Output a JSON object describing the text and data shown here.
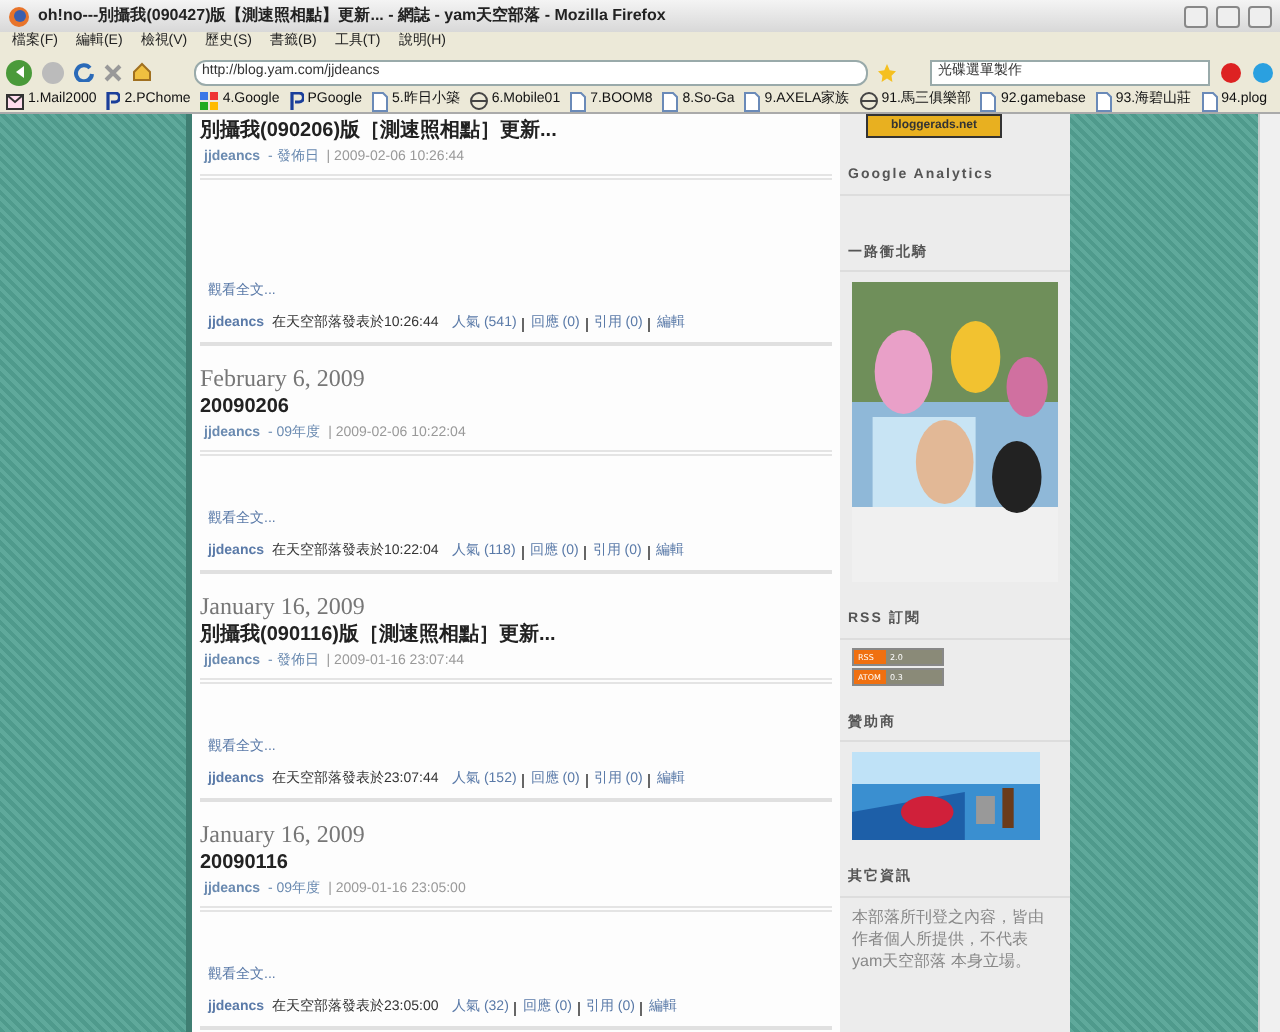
{
  "window": {
    "title": "oh!no---別攝我(090427)版【測速照相點】更新... - 網誌 - yam天空部落 - Mozilla Firefox"
  },
  "menu": [
    "檔案(F)",
    "編輯(E)",
    "檢視(V)",
    "歷史(S)",
    "書籤(B)",
    "工具(T)",
    "說明(H)"
  ],
  "address": {
    "value": "http://blog.yam.com/jjdeancs"
  },
  "search": {
    "value": "光碟選單製作"
  },
  "bookmarks": [
    {
      "label": "1.Mail2000",
      "kind": "mail"
    },
    {
      "label": "2.PChome",
      "kind": "p"
    },
    {
      "label": "4.Google",
      "kind": "google"
    },
    {
      "label": "PGoogle",
      "kind": "p"
    },
    {
      "label": "5.昨日小築",
      "kind": "page"
    },
    {
      "label": "6.Mobile01",
      "kind": "mobile"
    },
    {
      "label": "7.BOOM8",
      "kind": "page"
    },
    {
      "label": "8.So-Ga",
      "kind": "page"
    },
    {
      "label": "9.AXELA家族",
      "kind": "page"
    },
    {
      "label": "91.馬三俱樂部",
      "kind": "mobile"
    },
    {
      "label": "92.gamebase",
      "kind": "page"
    },
    {
      "label": "93.海碧山莊",
      "kind": "page"
    },
    {
      "label": "94.plog",
      "kind": "page"
    }
  ],
  "posts": [
    {
      "title": "別攝我(090206)版［測速照相點］更新...",
      "author": "jjdeancs",
      "category": "- 發佈日",
      "timestamp": "| 2009-02-06 10:26:44",
      "read_more": "觀看全文...",
      "footer_author": "jjdeancs",
      "footer_text": "在天空部落發表於10:26:44",
      "stats": [
        "人氣 (541)",
        "回應 (0)",
        "引用 (0)",
        "編輯"
      ]
    },
    {
      "date": "February 6, 2009",
      "title": "20090206",
      "author": "jjdeancs",
      "category": "- 09年度",
      "timestamp": "| 2009-02-06 10:22:04",
      "read_more": "觀看全文...",
      "footer_author": "jjdeancs",
      "footer_text": "在天空部落發表於10:22:04",
      "stats": [
        "人氣 (118)",
        "回應 (0)",
        "引用 (0)",
        "編輯"
      ]
    },
    {
      "date": "January 16, 2009",
      "title": "別攝我(090116)版［測速照相點］更新...",
      "author": "jjdeancs",
      "category": "- 發佈日",
      "timestamp": "| 2009-01-16 23:07:44",
      "read_more": "觀看全文...",
      "footer_author": "jjdeancs",
      "footer_text": "在天空部落發表於23:07:44",
      "stats": [
        "人氣 (152)",
        "回應 (0)",
        "引用 (0)",
        "編輯"
      ]
    },
    {
      "date": "January 16, 2009",
      "title": "20090116",
      "author": "jjdeancs",
      "category": "- 09年度",
      "timestamp": "| 2009-01-16 23:05:00",
      "read_more": "觀看全文...",
      "footer_author": "jjdeancs",
      "footer_text": "在天空部落發表於23:05:00",
      "stats": [
        "人氣 (32)",
        "回應 (0)",
        "引用 (0)",
        "編輯"
      ]
    }
  ],
  "sidebar": {
    "badge": "bloggerads.net",
    "sections": [
      {
        "heading": "Google Analytics",
        "kind": "empty"
      },
      {
        "heading": "一路衝北騎",
        "kind": "picture"
      },
      {
        "heading": "RSS 訂閱",
        "kind": "feeds",
        "feeds": [
          {
            "name": "RSS",
            "version": "2.0"
          },
          {
            "name": "ATOM",
            "version": "0.3"
          }
        ]
      },
      {
        "heading": "贊助商",
        "kind": "banner"
      },
      {
        "heading": "其它資訊",
        "kind": "text",
        "text": "本部落所刊登之內容，皆由作者個人所提供，不代表yam天空部落 本身立場。"
      }
    ]
  }
}
